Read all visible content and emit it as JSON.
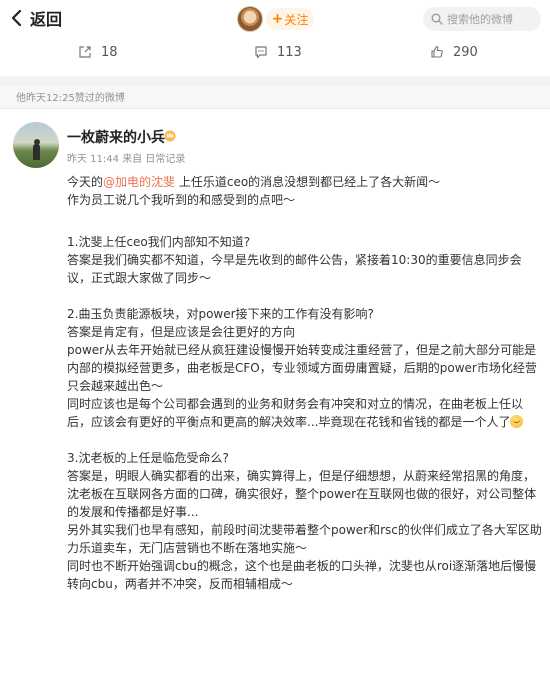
{
  "header": {
    "back_label": "返回",
    "follow_label": "关注",
    "search_placeholder": "搜索他的微博"
  },
  "stats": {
    "reposts": "18",
    "comments": "113",
    "likes": "290"
  },
  "liked_notice": "他昨天12:25赞过的微博",
  "post": {
    "username": "一枚蔚来的小兵",
    "time": "昨天 11:44",
    "source": "来自 日常记录",
    "intro_prefix": "今天的",
    "mention": "@加电的沈斐",
    "intro_suffix": " 上任乐道ceo的消息没想到都已经上了各大新闻～",
    "intro_line2": "作为员工说几个我听到的和感受到的点吧～",
    "q1": "1.沈斐上任ceo我们内部知不知道?",
    "a1": "答案是我们确实都不知道，今早是先收到的邮件公告，紧接着10:30的重要信息同步会议，正式跟大家做了同步～",
    "q2": "2.曲玉负责能源板块，对power接下来的工作有没有影响?",
    "a2_line1": "答案是肯定有，但是应该是会往更好的方向",
    "a2_line2": "power从去年开始就已经从疯狂建设慢慢开始转变成注重经营了，但是之前大部分可能是内部的模拟经营更多，曲老板是CFO，专业领域方面毋庸置疑，后期的power市场化经营只会越来越出色～",
    "a2_line3": "同时应该也是每个公司都会遇到的业务和财务会有冲突和对立的情况，在曲老板上任以后，应该会有更好的平衡点和更高的解决效率...毕竟现在花钱和省钱的都是一个人了",
    "q3": "3.沈老板的上任是临危受命么?",
    "a3_line1": "答案是，明眼人确实都看的出来，确实算得上，但是仔细想想，从蔚来经常招黑的角度，沈老板在互联网各方面的口碑，确实很好，整个power在互联网也做的很好，对公司整体的发展和传播都是好事...",
    "a3_line2": "另外其实我们也早有感知，前段时间沈斐带着整个power和rsc的伙伴们成立了各大军区助力乐道卖车，无门店营销也不断在落地实施～",
    "a3_line3": "同时也不断开始强调cbu的概念，这个也是曲老板的口头禅，沈斐也从roi逐渐落地后慢慢转向cbu，两者并不冲突，反而相辅相成～"
  },
  "icons": {
    "back": "chevron-left-icon",
    "search": "search-icon",
    "repost": "repost-icon",
    "comment": "comment-icon",
    "like": "like-icon",
    "badge": "crown-badge-icon",
    "emoji": "laughing-emoji-icon"
  },
  "colors": {
    "accent": "#ff8200",
    "mention": "#eb7350",
    "muted": "#939393"
  }
}
